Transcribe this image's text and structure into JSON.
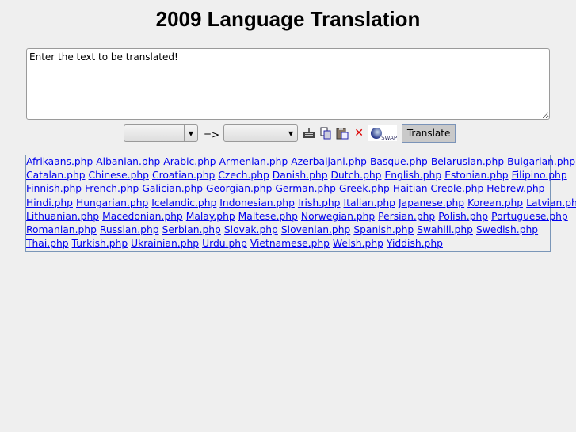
{
  "title": "2009 Language Translation",
  "input": {
    "value": "Enter the text to be translated!"
  },
  "toolbar": {
    "source_language": "",
    "arrow": "=>",
    "target_language": "",
    "swap_label": "SWAP",
    "translate_label": "Translate",
    "icons": [
      "keyboard-icon",
      "copy-icon",
      "paste-icon",
      "clear-icon",
      "swap-icon"
    ]
  },
  "links": [
    [
      "Afrikaans.php",
      "Albanian.php",
      "Arabic.php",
      "Armenian.php",
      "Azerbaijani.php",
      "Basque.php",
      "Belarusian.php",
      "Bulgarian.php"
    ],
    [
      "Catalan.php",
      "Chinese.php",
      "Croatian.php",
      "Czech.php",
      "Danish.php",
      "Dutch.php",
      "English.php",
      "Estonian.php",
      "Filipino.php"
    ],
    [
      "Finnish.php",
      "French.php",
      "Galician.php",
      "Georgian.php",
      "German.php",
      "Greek.php",
      "Haitian Creole.php",
      "Hebrew.php"
    ],
    [
      "Hindi.php",
      "Hungarian.php",
      "Icelandic.php",
      "Indonesian.php",
      "Irish.php",
      "Italian.php",
      "Japanese.php",
      "Korean.php",
      "Latvian.php"
    ],
    [
      "Lithuanian.php",
      "Macedonian.php",
      "Malay.php",
      "Maltese.php",
      "Norwegian.php",
      "Persian.php",
      "Polish.php",
      "Portuguese.php"
    ],
    [
      "Romanian.php",
      "Russian.php",
      "Serbian.php",
      "Slovak.php",
      "Slovenian.php",
      "Spanish.php",
      "Swahili.php",
      "Swedish.php"
    ],
    [
      "Thai.php",
      "Turkish.php",
      "Ukrainian.php",
      "Urdu.php",
      "Vietnamese.php",
      "Welsh.php",
      "Yiddish.php"
    ]
  ]
}
